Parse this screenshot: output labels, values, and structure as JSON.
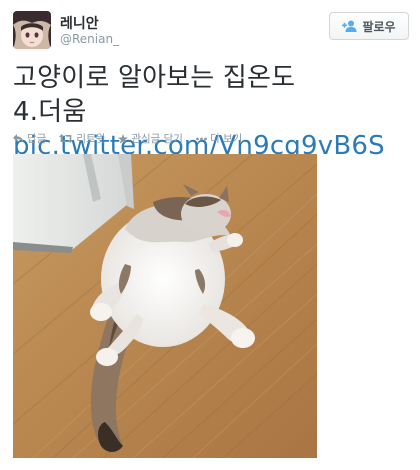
{
  "user": {
    "name": "레니안",
    "handle": "@Renian_"
  },
  "follow_button": {
    "label": "팔로우",
    "icon": "add-user-icon"
  },
  "tweet": {
    "text_line1": "고양이로 알아보는 집온도",
    "text_line2_prefix": "4.더움",
    "link": "pic.twitter.com/Vn9cq9vB6S"
  },
  "actions": {
    "reply": {
      "label": "답글",
      "icon": "reply-icon"
    },
    "retweet": {
      "label": "리트윗",
      "icon": "retweet-icon"
    },
    "favorite": {
      "label": "관심글 담기",
      "icon": "star-icon"
    },
    "more": {
      "label": "더 보기",
      "icon": "more-dots-icon"
    }
  },
  "colors": {
    "link": "#2b7bb9",
    "muted": "#8899a6",
    "text": "#292f33"
  }
}
